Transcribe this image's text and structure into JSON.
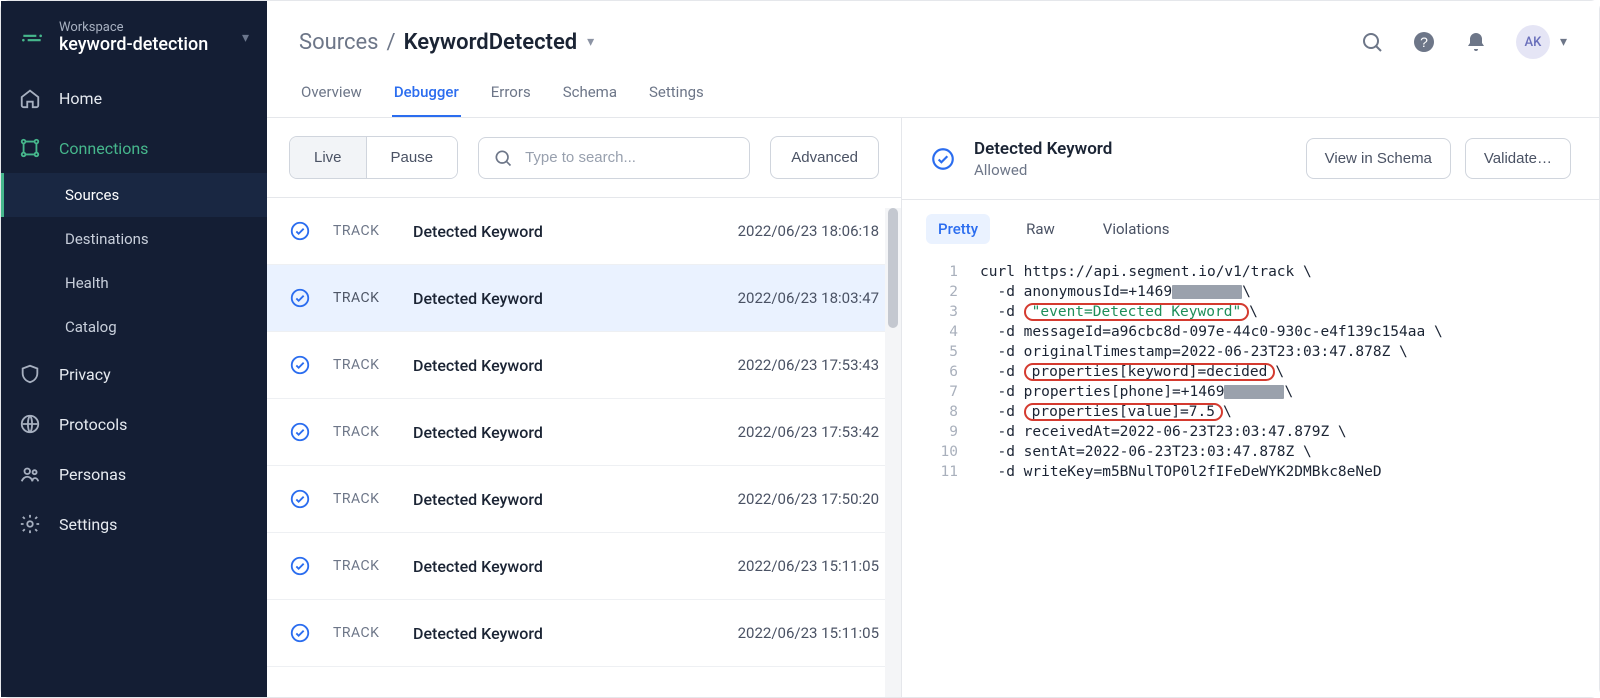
{
  "workspace": {
    "label": "Workspace",
    "name": "keyword-detection"
  },
  "nav": {
    "home": "Home",
    "connections": "Connections",
    "privacy": "Privacy",
    "protocols": "Protocols",
    "personas": "Personas",
    "settings": "Settings"
  },
  "subnav": {
    "sources": "Sources",
    "destinations": "Destinations",
    "health": "Health",
    "catalog": "Catalog"
  },
  "breadcrumb": {
    "parent": "Sources",
    "current": "KeywordDetected"
  },
  "avatar": "AK",
  "tabs": {
    "overview": "Overview",
    "debugger": "Debugger",
    "errors": "Errors",
    "schema": "Schema",
    "settings": "Settings"
  },
  "toolbar": {
    "live": "Live",
    "pause": "Pause",
    "search_placeholder": "Type to search...",
    "advanced": "Advanced"
  },
  "events": {
    "type_label": "TRACK",
    "rows": [
      {
        "name": "Detected Keyword",
        "ts": "2022/06/23 18:06:18"
      },
      {
        "name": "Detected Keyword",
        "ts": "2022/06/23 18:03:47"
      },
      {
        "name": "Detected Keyword",
        "ts": "2022/06/23 17:53:43"
      },
      {
        "name": "Detected Keyword",
        "ts": "2022/06/23 17:53:42"
      },
      {
        "name": "Detected Keyword",
        "ts": "2022/06/23 17:50:20"
      },
      {
        "name": "Detected Keyword",
        "ts": "2022/06/23 15:11:05"
      },
      {
        "name": "Detected Keyword",
        "ts": "2022/06/23 15:11:05"
      }
    ]
  },
  "detail": {
    "title": "Detected Keyword",
    "status": "Allowed",
    "view_in_schema": "View in Schema",
    "validate": "Validate…",
    "tabs": {
      "pretty": "Pretty",
      "raw": "Raw",
      "violations": "Violations"
    },
    "code": {
      "l1": "curl https://api.segment.io/v1/track \\",
      "l2a": "  -d anonymousId=+1469",
      "l2b": " \\",
      "l3a": "  -d ",
      "l3b": "\"event=Detected Keyword\"",
      "l3c": " \\",
      "l4": "  -d messageId=a96cbc8d-097e-44c0-930c-e4f139c154aa \\",
      "l5": "  -d originalTimestamp=2022-06-23T23:03:47.878Z \\",
      "l6a": "  -d ",
      "l6b": "properties[keyword]=decided",
      "l6c": " \\",
      "l7a": "  -d properties[phone]=+1469",
      "l7b": " \\",
      "l8a": "  -d ",
      "l8b": "properties[value]=7.5",
      "l8c": " \\",
      "l9": "  -d receivedAt=2022-06-23T23:03:47.879Z \\",
      "l10": "  -d sentAt=2022-06-23T23:03:47.878Z \\",
      "l11": "  -d writeKey=m5BNulTOP0l2fIFeDeWYK2DMBkc8eNeD"
    }
  }
}
